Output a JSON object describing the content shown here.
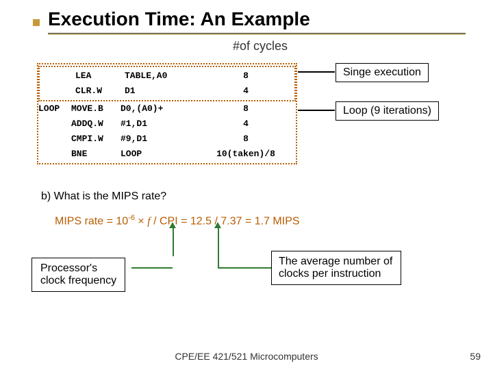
{
  "title": "Execution Time: An Example",
  "cycles_label": "#of cycles",
  "code": {
    "top": [
      {
        "label": "",
        "op": "LEA",
        "args": "TABLE,A0",
        "cyc": "8"
      },
      {
        "label": "",
        "op": "CLR.W",
        "args": "D1",
        "cyc": "4"
      }
    ],
    "body": [
      {
        "label": "LOOP",
        "op": "MOVE.B",
        "args": "D0,(A0)+",
        "cyc": "8"
      },
      {
        "label": "",
        "op": "ADDQ.W",
        "args": "#1,D1",
        "cyc": "4"
      },
      {
        "label": "",
        "op": "CMPI.W",
        "args": "#9,D1",
        "cyc": "8"
      },
      {
        "label": "",
        "op": "BNE",
        "args": "LOOP",
        "cyc": "10(taken)/8"
      }
    ]
  },
  "callouts": {
    "single": "Singe execution",
    "loop": "Loop (9 iterations)"
  },
  "question": "b) What is the MIPS rate?",
  "equation": {
    "lhs": "MIPS rate = 10",
    "exp": "-6",
    "mid1": " × ",
    "f": "f",
    "mid2": " / CPI = 12.5 / 7.37 = ",
    "ans": "1.7 MIPS"
  },
  "box_left_l1": "Processor's",
  "box_left_l2": "clock frequency",
  "box_right": "The average number of clocks per instruction",
  "footer": "CPE/EE 421/521 Microcomputers",
  "page": "59"
}
